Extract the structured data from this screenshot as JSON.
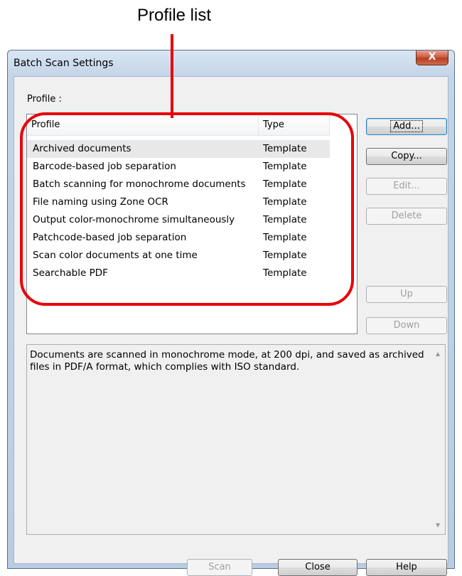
{
  "callout": {
    "label": "Profile list",
    "color": "#e8000b"
  },
  "window": {
    "title": "Batch Scan Settings",
    "close_glyph": "X"
  },
  "profile_caption": "Profile :",
  "list": {
    "columns": {
      "profile": "Profile",
      "type": "Type"
    },
    "rows": [
      {
        "name": "Archived documents",
        "type": "Template"
      },
      {
        "name": "Barcode-based job separation",
        "type": "Template"
      },
      {
        "name": "Batch scanning for monochrome documents",
        "type": "Template"
      },
      {
        "name": "File naming using Zone OCR",
        "type": "Template"
      },
      {
        "name": "Output color-monochrome simultaneously",
        "type": "Template"
      },
      {
        "name": "Patchcode-based job separation",
        "type": "Template"
      },
      {
        "name": "Scan color documents at one time",
        "type": "Template"
      },
      {
        "name": "Searchable PDF",
        "type": "Template"
      }
    ]
  },
  "buttons": {
    "add": "Add...",
    "copy": "Copy...",
    "edit": "Edit...",
    "delete": "Delete",
    "up": "Up",
    "down": "Down",
    "scan": "Scan",
    "close": "Close",
    "help": "Help"
  },
  "description": "Documents are scanned in monochrome mode, at 200 dpi, and saved as archived files in PDF/A format, which complies with ISO standard.",
  "icons": {
    "scroll_up": "scroll-up-arrow-icon",
    "scroll_down": "scroll-down-arrow-icon"
  }
}
